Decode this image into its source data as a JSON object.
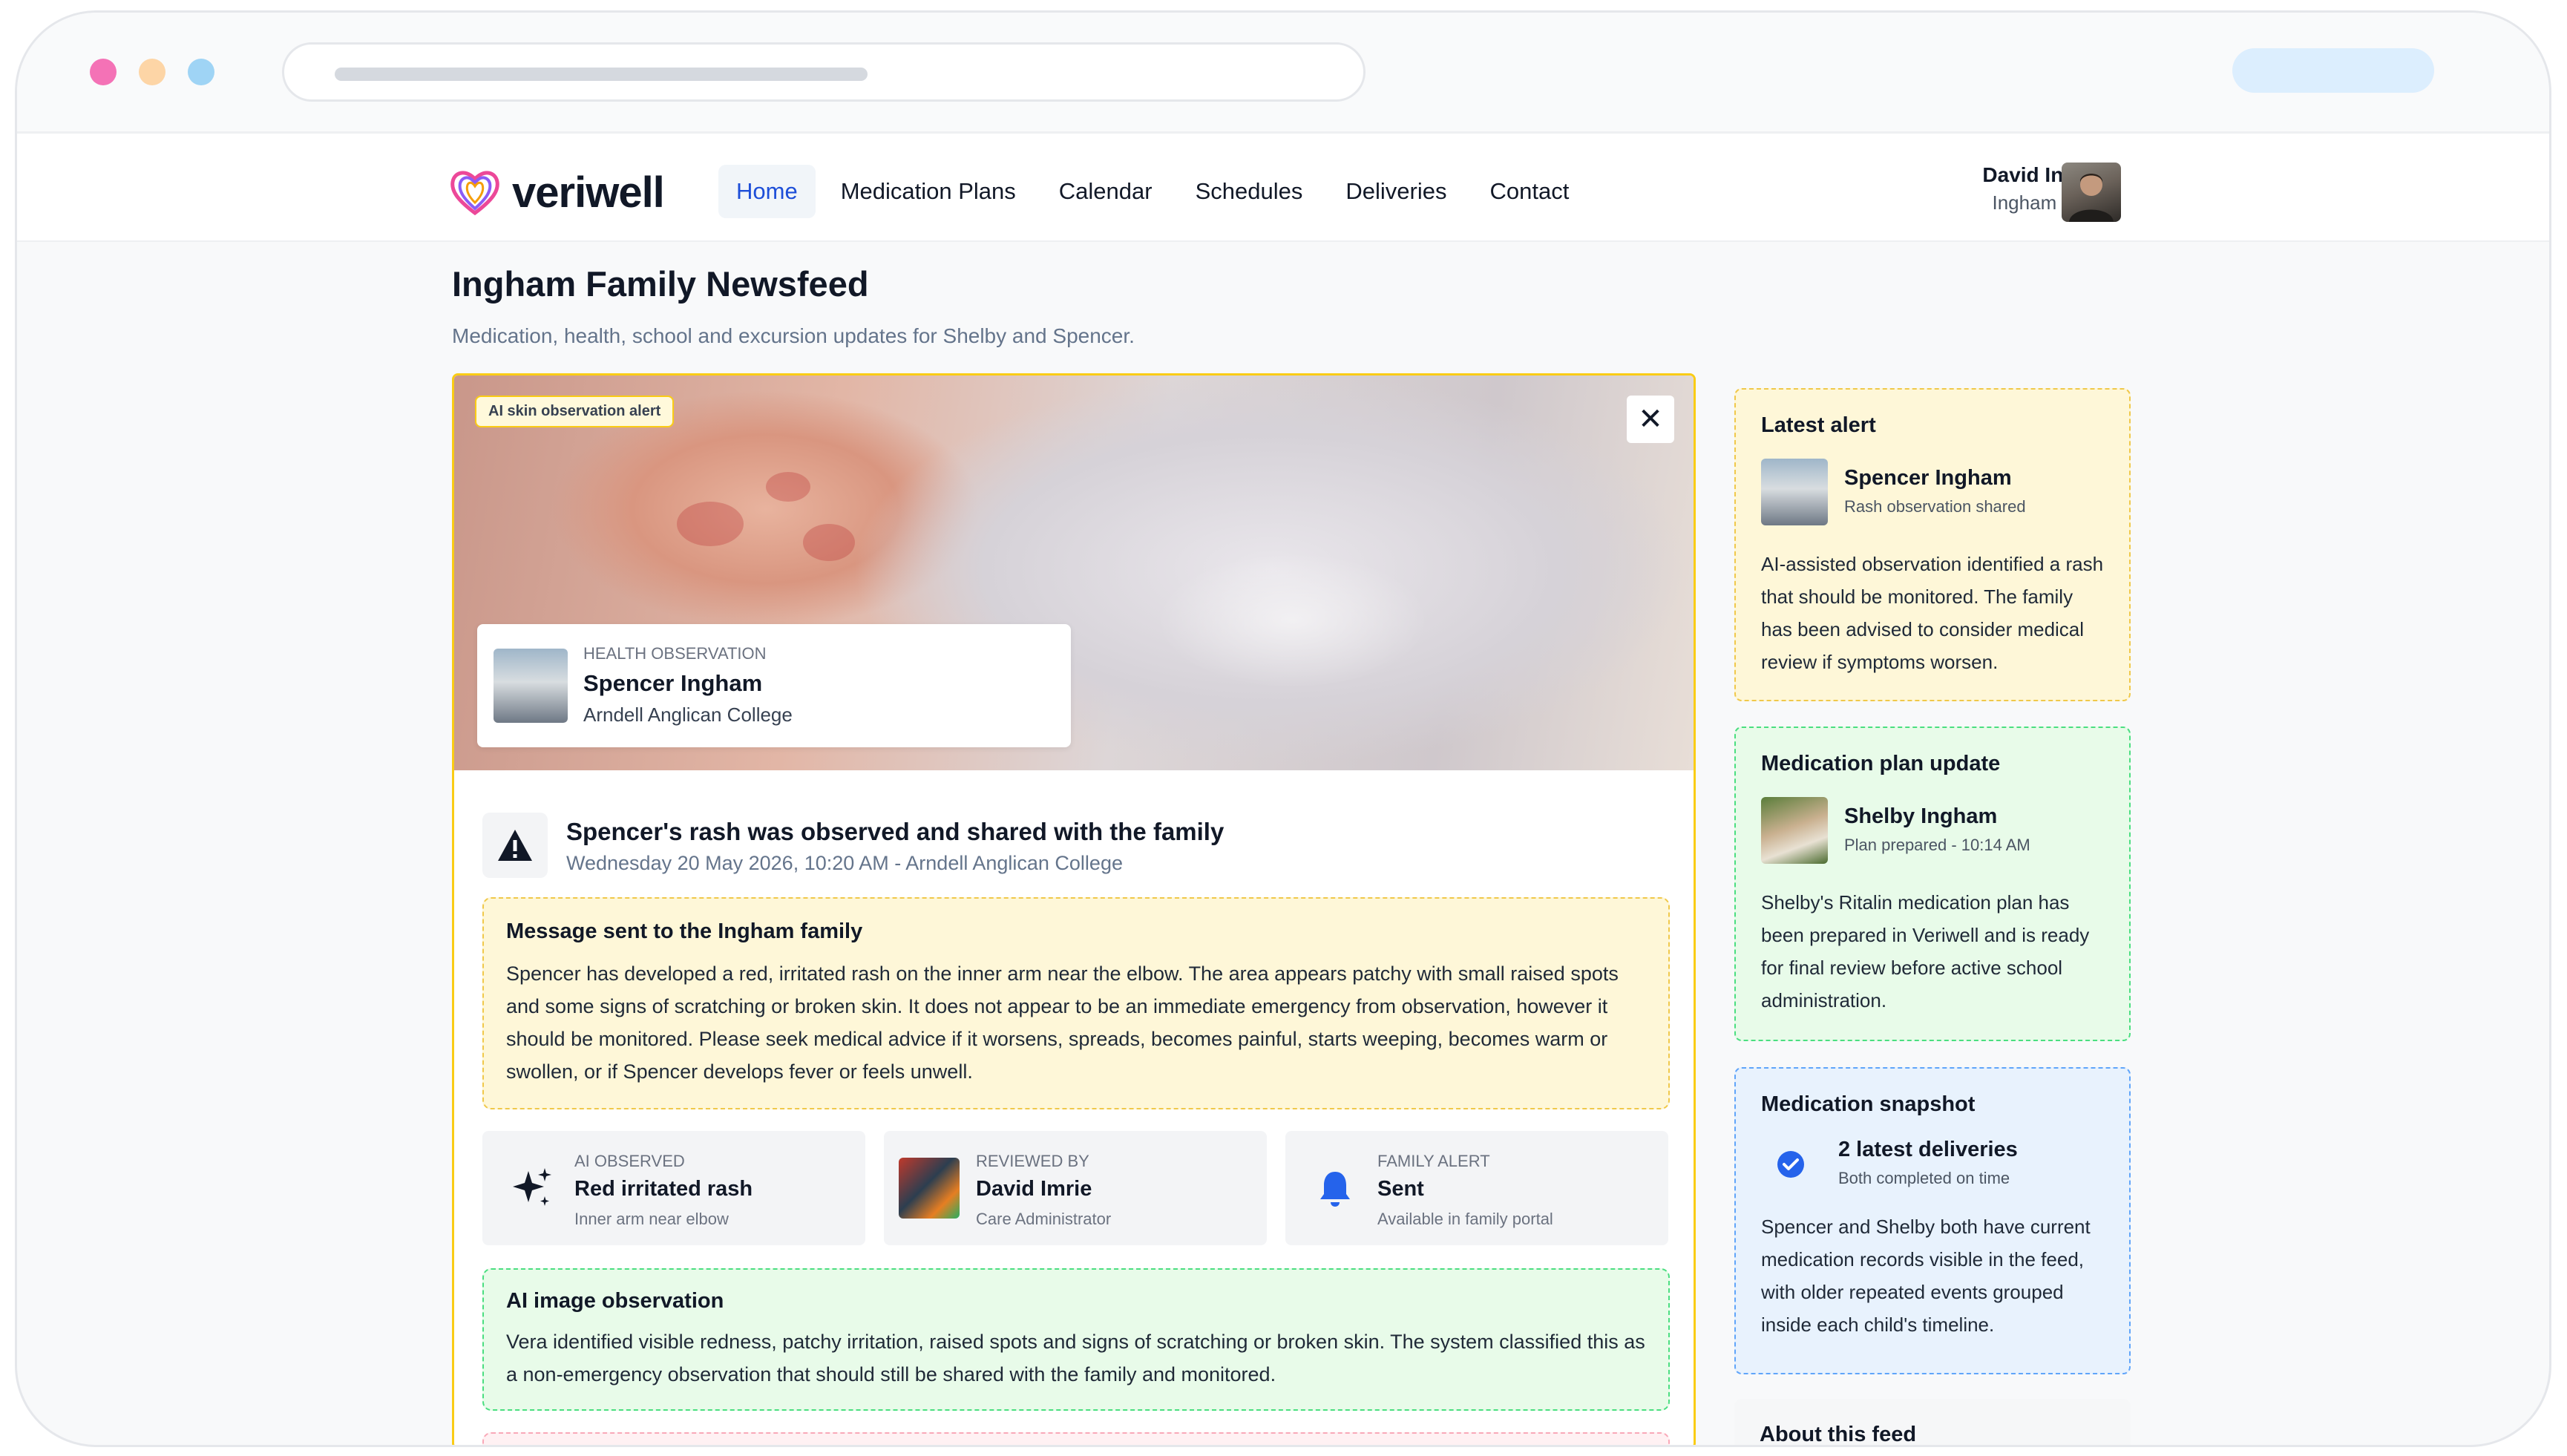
{
  "brand": {
    "name": "veriwell"
  },
  "nav": {
    "items": [
      "Home",
      "Medication Plans",
      "Calendar",
      "Schedules",
      "Deliveries",
      "Contact"
    ],
    "active": "Home"
  },
  "user": {
    "name": "David Ingham",
    "family": "Ingham Family"
  },
  "page": {
    "title": "Ingham Family Newsfeed",
    "subtitle": "Medication, health, school and excursion updates for Shelby and Spencer."
  },
  "feed_item": {
    "tag": "AI skin observation alert",
    "observation": {
      "kicker": "HEALTH OBSERVATION",
      "name": "Spencer Ingham",
      "school": "Arndell Anglican College"
    },
    "title": "Spencer's rash was observed and shared with the family",
    "meta": "Wednesday 20 May 2026, 10:20 AM - Arndell Anglican College",
    "message": {
      "heading": "Message sent to the Ingham family",
      "body": "Spencer has developed a red, irritated rash on the inner arm near the elbow. The area appears patchy with small raised spots and some signs of scratching or broken skin. It does not appear to be an immediate emergency from observation, however it should be monitored. Please seek medical advice if it worsens, spreads, becomes painful, starts weeping, becomes warm or swollen, or if Spencer develops fever or feels unwell."
    },
    "stats": [
      {
        "kicker": "AI OBSERVED",
        "value": "Red irritated rash",
        "sub": "Inner arm near elbow",
        "icon": "sparkles-icon"
      },
      {
        "kicker": "REVIEWED BY",
        "value": "David Imrie",
        "sub": "Care Administrator",
        "icon": "reviewer-photo"
      },
      {
        "kicker": "FAMILY ALERT",
        "value": "Sent",
        "sub": "Available in family portal",
        "icon": "bell-icon"
      }
    ],
    "ai_observation": {
      "heading": "AI image observation",
      "body": "Vera identified visible redness, patchy irritation, raised spots and signs of scratching or broken skin. The system classified this as a non-emergency observation that should still be shared with the family and monitored."
    }
  },
  "sidebar": {
    "latest_alert": {
      "heading": "Latest alert",
      "name": "Spencer Ingham",
      "sub": "Rash observation shared",
      "body": "AI-assisted observation identified a rash that should be monitored. The family has been advised to consider medical review if symptoms worsen."
    },
    "plan_update": {
      "heading": "Medication plan update",
      "name": "Shelby Ingham",
      "sub": "Plan prepared - 10:14 AM",
      "body": "Shelby's Ritalin medication plan has been prepared in Veriwell and is ready for final review before active school administration."
    },
    "snapshot": {
      "heading": "Medication snapshot",
      "name": "2 latest deliveries",
      "sub": "Both completed on time",
      "body": "Spencer and Shelby both have current medication records visible in the feed, with older repeated events grouped inside each child's timeline."
    },
    "about": {
      "heading": "About this feed"
    }
  },
  "colors": {
    "accent": "#1d4ed8",
    "alert_bg": "#fef7d8",
    "success_bg": "#e8fbe9",
    "info_bg": "#e8f2fd"
  }
}
